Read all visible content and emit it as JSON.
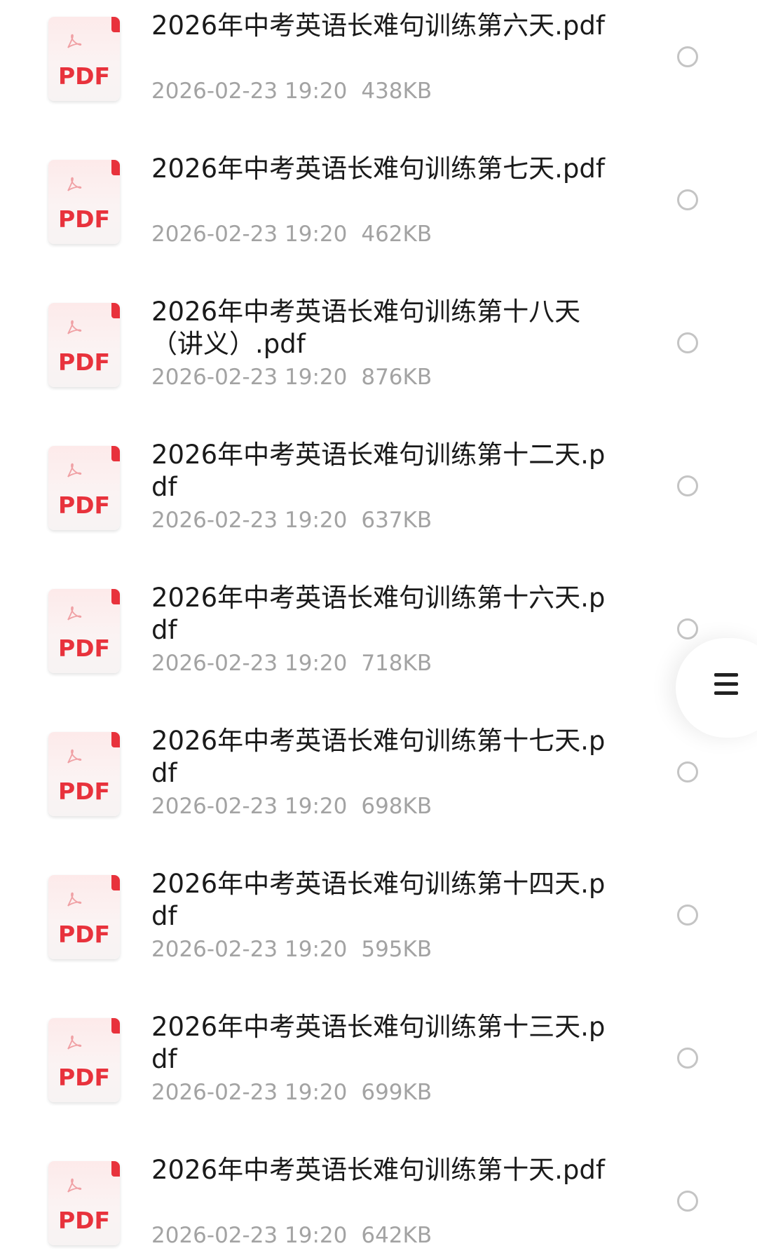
{
  "files": [
    {
      "name": "2026年中考英语长难句训练第六天.pdf",
      "date": "2026-02-23 19:20",
      "size": "438KB",
      "icon_label": "PDF"
    },
    {
      "name": "2026年中考英语长难句训练第七天.pdf",
      "date": "2026-02-23 19:20",
      "size": "462KB",
      "icon_label": "PDF"
    },
    {
      "name": "2026年中考英语长难句训练第十八天（讲义）.pdf",
      "date": "2026-02-23 19:20",
      "size": "876KB",
      "icon_label": "PDF"
    },
    {
      "name": "2026年中考英语长难句训练第十二天.pdf",
      "date": "2026-02-23 19:20",
      "size": "637KB",
      "icon_label": "PDF"
    },
    {
      "name": "2026年中考英语长难句训练第十六天.pdf",
      "date": "2026-02-23 19:20",
      "size": "718KB",
      "icon_label": "PDF"
    },
    {
      "name": "2026年中考英语长难句训练第十七天.pdf",
      "date": "2026-02-23 19:20",
      "size": "698KB",
      "icon_label": "PDF"
    },
    {
      "name": "2026年中考英语长难句训练第十四天.pdf",
      "date": "2026-02-23 19:20",
      "size": "595KB",
      "icon_label": "PDF"
    },
    {
      "name": "2026年中考英语长难句训练第十三天.pdf",
      "date": "2026-02-23 19:20",
      "size": "699KB",
      "icon_label": "PDF"
    },
    {
      "name": "2026年中考英语长难句训练第十天.pdf",
      "date": "2026-02-23 19:20",
      "size": "642KB",
      "icon_label": "PDF"
    }
  ],
  "icons": {
    "file_icon": "pdf-file-icon",
    "select": "radio-unchecked-icon",
    "floating_menu": "hamburger-menu-icon"
  },
  "colors": {
    "pdf_red": "#e8323c",
    "meta_gray": "#a3a3a3",
    "title_text": "#1a1a1a",
    "radio_border": "#c4c4c4"
  }
}
